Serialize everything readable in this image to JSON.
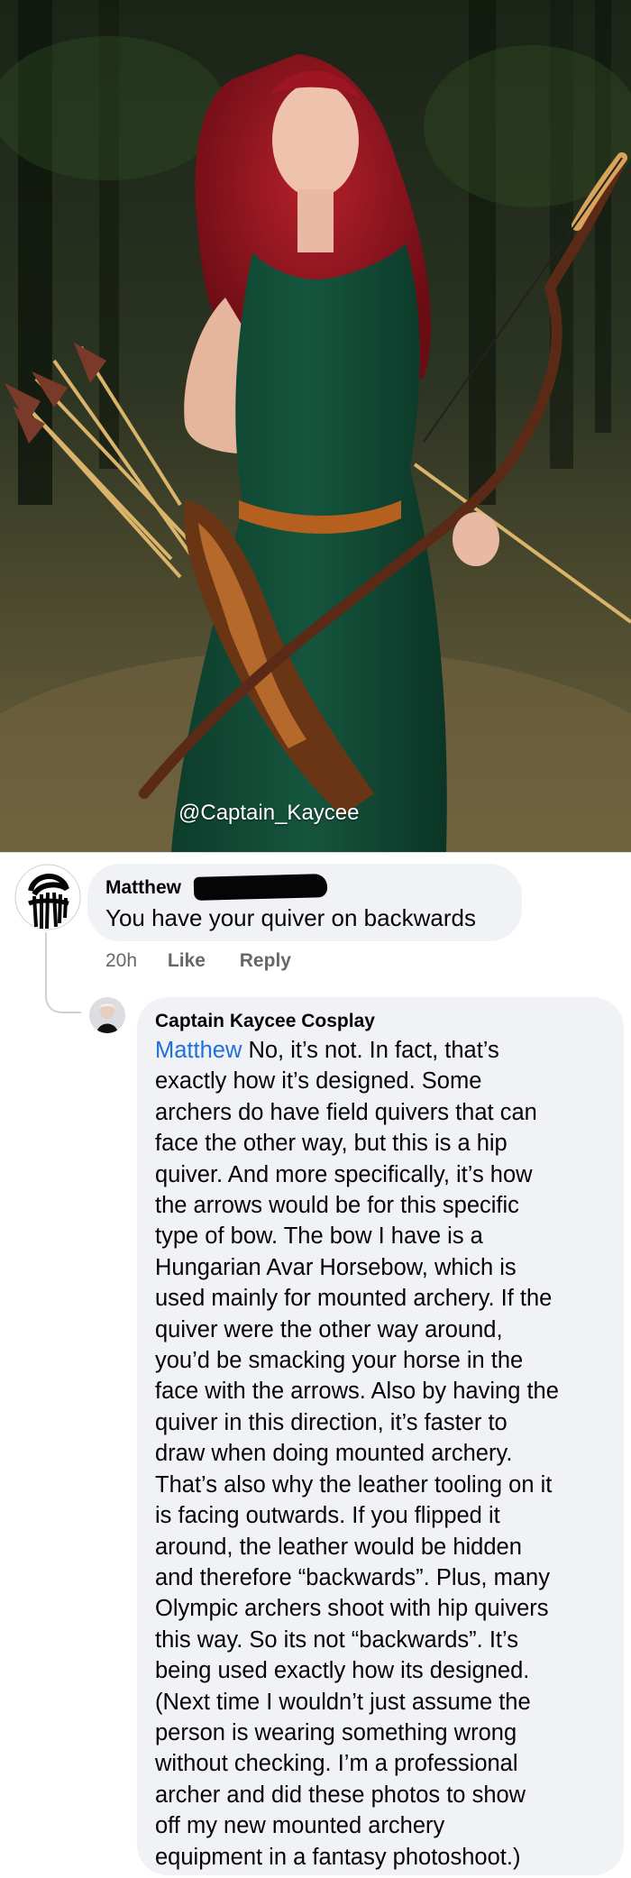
{
  "photo": {
    "watermark": "@Captain_Kaycee"
  },
  "comment": {
    "author": "Matthew",
    "text": "You have your quiver on backwards",
    "time": "20h",
    "like_label": "Like",
    "reply_label": "Reply"
  },
  "reply": {
    "author": "Captain Kaycee Cosplay",
    "mention": "Matthew",
    "text": " No, it’s not. In fact, that’s\nexactly how it’s designed. Some\narchers do have field quivers that can\nface the other way, but this is a hip\nquiver. And more specifically, it’s how\nthe arrows would be for this specific\ntype of bow. The bow I have is a\nHungarian Avar Horsebow, which is\nused mainly for mounted archery. If the\nquiver were the other way around,\nyou’d be smacking your horse in the\nface with the arrows. Also by having the\nquiver in this direction, it’s faster to\ndraw when doing mounted archery.\nThat’s also why the leather tooling on it\nis facing outwards. If you flipped it\naround, the leather would be hidden\nand therefore “backwards”. Plus, many\nOlympic archers shoot with hip quivers\nthis way. So its not “backwards”. It’s\nbeing used exactly how its designed.\n(Next time I wouldn’t just assume the\nperson is wearing something wrong\nwithout checking. I’m a professional\narcher and did these photos to show\noff my new mounted archery\nequipment in a fantasy photoshoot.)"
  },
  "colors": {
    "bubble": "#f0f2f5",
    "mention": "#216fdb",
    "meta": "#65676b"
  }
}
